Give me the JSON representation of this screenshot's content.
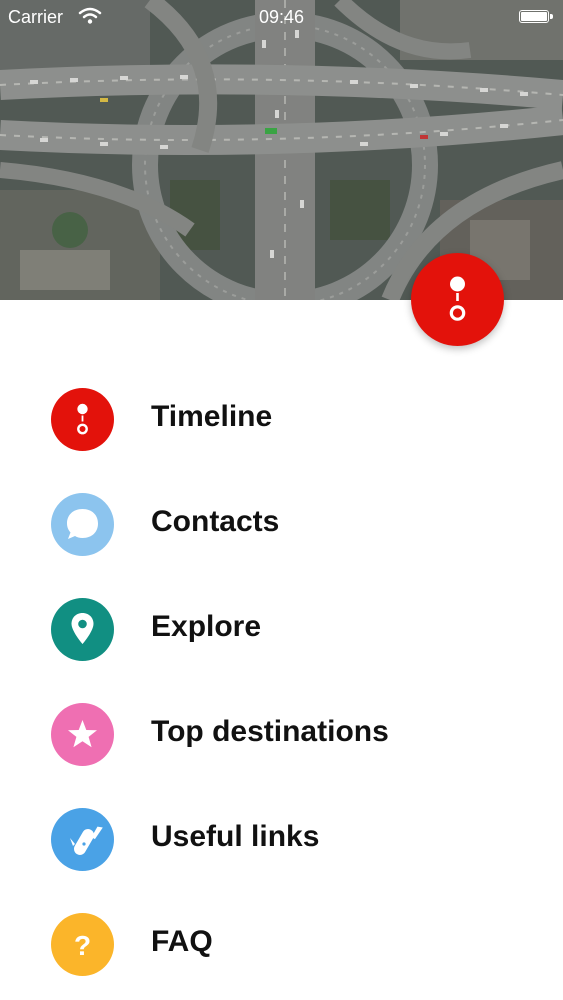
{
  "status_bar": {
    "carrier": "Carrier",
    "time": "09:46"
  },
  "colors": {
    "fab": "#e3120b",
    "timeline": "#e3120b",
    "contacts": "#8cc4ee",
    "explore": "#118f82",
    "top_destinations": "#ef6fb2",
    "useful_links": "#4aa2e6",
    "faq": "#fbb52a"
  },
  "header_image": {
    "subject": "aerial highway interchange photo"
  },
  "fab_icon": "timeline-icon",
  "menu": {
    "items": [
      {
        "label": "Timeline",
        "icon": "timeline-icon"
      },
      {
        "label": "Contacts",
        "icon": "chat-bubble-icon"
      },
      {
        "label": "Explore",
        "icon": "map-pin-icon"
      },
      {
        "label": "Top destinations",
        "icon": "star-icon"
      },
      {
        "label": "Useful links",
        "icon": "swiss-knife-icon"
      },
      {
        "label": "FAQ",
        "icon": "question-icon"
      }
    ]
  }
}
